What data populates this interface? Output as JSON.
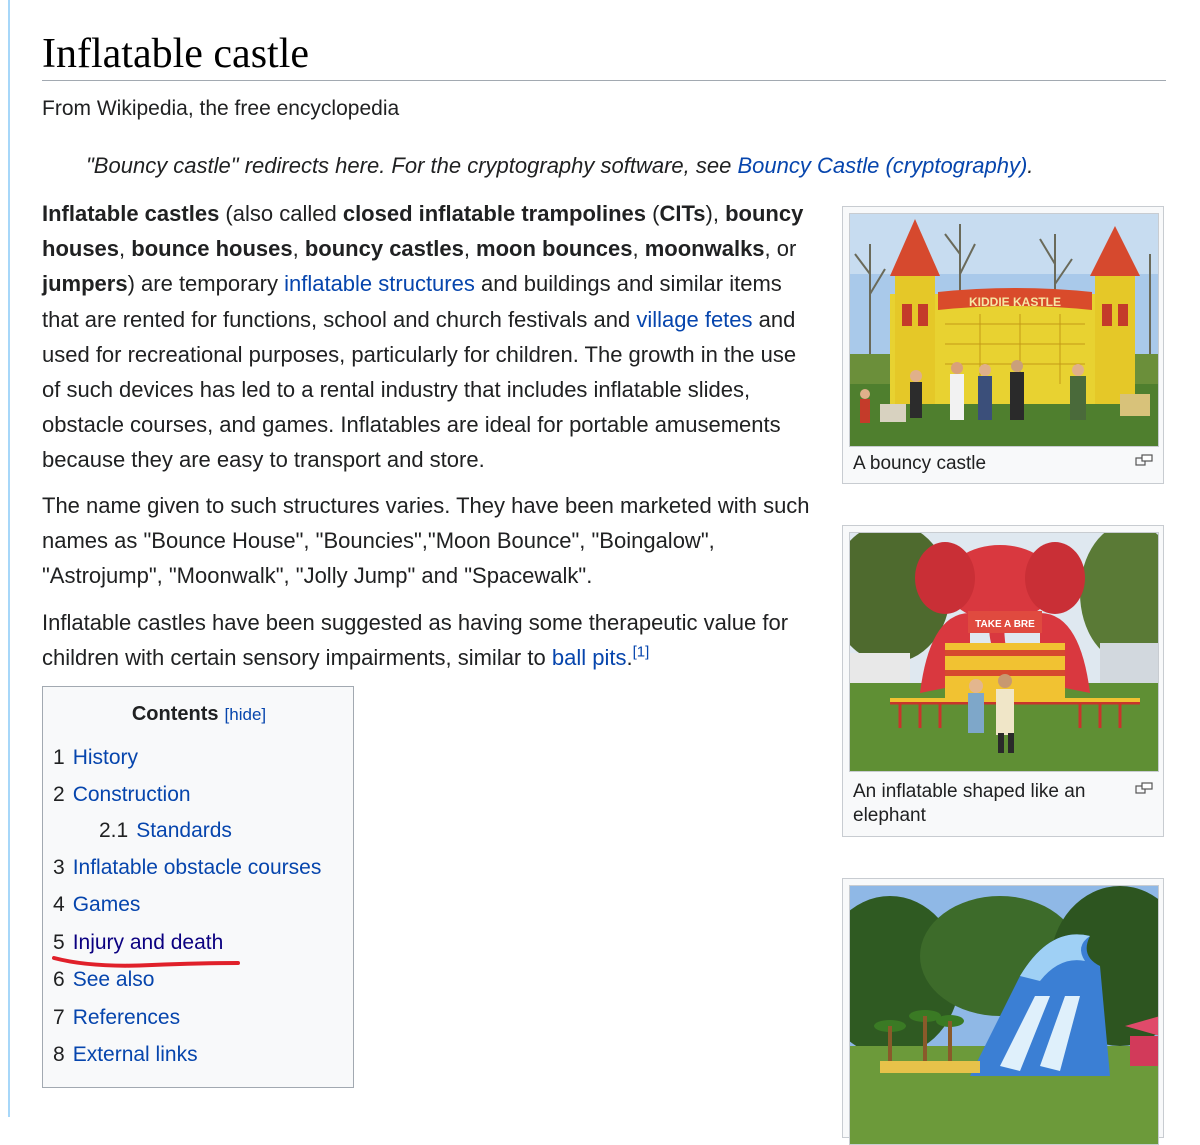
{
  "article": {
    "title": "Inflatable castle",
    "tagline": "From Wikipedia, the free encyclopedia",
    "hatnote": {
      "text_before": "\"Bouncy castle\" redirects here. For the cryptography software, see ",
      "link": "Bouncy Castle (cryptography)",
      "text_after": "."
    },
    "p1": {
      "s1": "Inflatable castles",
      "s2": " (also called ",
      "s3": "closed inflatable trampolines",
      "s4": " (",
      "s5": "CITs",
      "s6": "), ",
      "s7": "bouncy houses",
      "s8": ", ",
      "s9": "bounce houses",
      "s10": ", ",
      "s11": "bouncy castles",
      "s12": ", ",
      "s13": "moon bounces",
      "s14": ", ",
      "s15": "moonwalks",
      "s16": ", or ",
      "s17": "jumpers",
      "s18": ") are temporary ",
      "link1": "inflatable structures",
      "s19": " and buildings and similar items that are rented for functions, school and church festivals and ",
      "link2": "village fetes",
      "s20": " and used for recreational purposes, particularly for children. The growth in the use of such devices has led to a rental industry that includes inflatable slides, obstacle courses, and games. Inflatables are ideal for portable amusements because they are easy to transport and store."
    },
    "p2": "The name given to such structures varies. They have been marketed with such names as \"Bounce House\", \"Bouncies\",\"Moon Bounce\", \"Boingalow\", \"Astrojump\", \"Moonwalk\", \"Jolly Jump\" and \"Spacewalk\".",
    "p3": {
      "text": "Inflatable castles have been suggested as having some therapeutic value for children with certain sensory impairments, similar to ",
      "link": "ball pits",
      "after": ".",
      "ref": "[1]"
    }
  },
  "images": [
    {
      "caption": "A bouncy castle",
      "sign": "KIDDIE KASTLE"
    },
    {
      "caption": "An inflatable shaped like an elephant",
      "sign": "TAKE A BRE"
    },
    {
      "caption": ""
    }
  ],
  "toc": {
    "title": "Contents",
    "hide": "[hide]",
    "items": [
      {
        "num": "1",
        "label": "History"
      },
      {
        "num": "2",
        "label": "Construction"
      },
      {
        "num": "2.1",
        "label": "Standards"
      },
      {
        "num": "3",
        "label": "Inflatable obstacle courses"
      },
      {
        "num": "4",
        "label": "Games"
      },
      {
        "num": "5",
        "label": "Injury and death"
      },
      {
        "num": "6",
        "label": "See also"
      },
      {
        "num": "7",
        "label": "References"
      },
      {
        "num": "8",
        "label": "External links"
      }
    ]
  },
  "colors": {
    "link": "#0645ad",
    "visited": "#0b0080",
    "annotation": "#e0202a"
  }
}
